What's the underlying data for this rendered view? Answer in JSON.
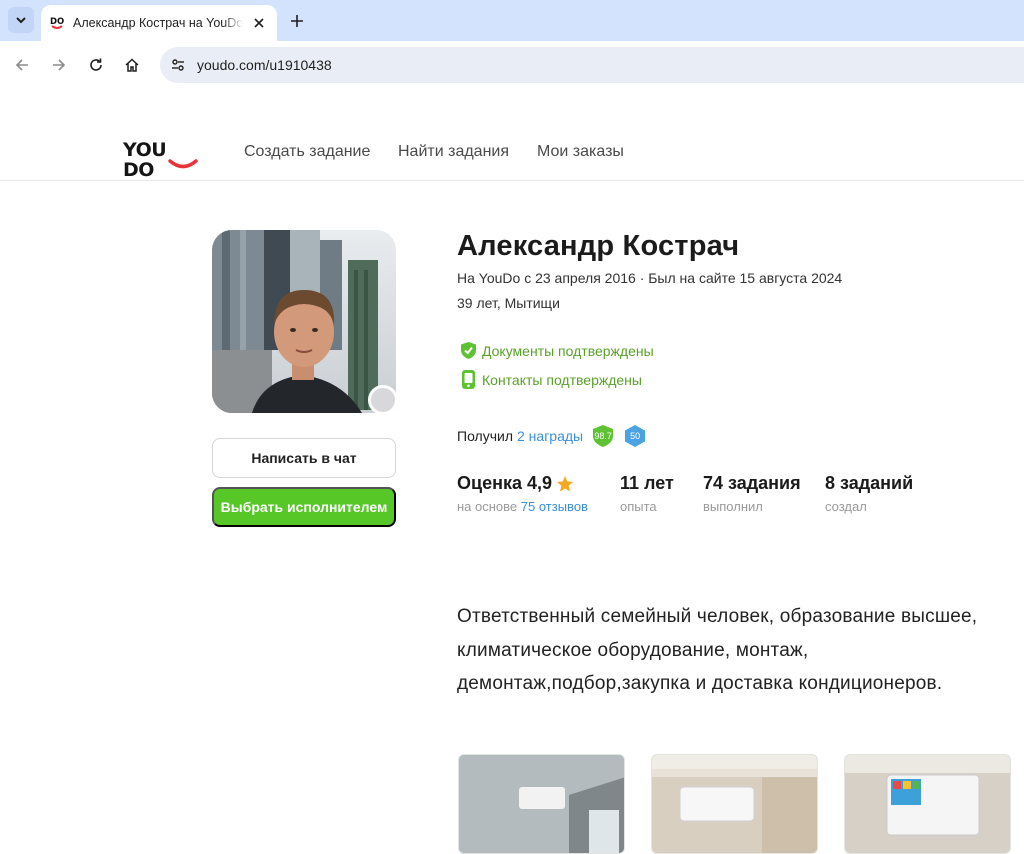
{
  "browser": {
    "tab_title": "Александр Кострач на YouDo",
    "favicon_text": "DO",
    "url": "youdo.com/u1910438"
  },
  "site": {
    "logo_text_1": "YOU",
    "logo_text_2": "DO",
    "nav": [
      "Создать задание",
      "Найти задания",
      "Мои заказы"
    ],
    "colors": {
      "brand_red": "#e8333b",
      "green": "#57c728",
      "link": "#3a8fd8"
    }
  },
  "profile": {
    "name": "Александр Кострач",
    "since": "На YouDo с 23 апреля 2016 · Был на сайте 15 августа 2024",
    "age_city": "39 лет, Мытищи",
    "verifications": [
      "Документы подтверждены",
      "Контакты подтверждены"
    ],
    "awards_prefix": "Получил",
    "awards_link": "2 награды",
    "badges": [
      "98.7",
      "50"
    ],
    "buttons": {
      "chat": "Написать в чат",
      "choose": "Выбрать исполнителем"
    },
    "stats": [
      {
        "value": "Оценка 4,9",
        "sub_prefix": "на основе",
        "sub_link": "75 отзывов",
        "icon": "star-icon"
      },
      {
        "value": "11 лет",
        "sub": "опыта"
      },
      {
        "value": "74 задания",
        "sub": "выполнил"
      },
      {
        "value": "8 заданий",
        "sub": "создал"
      }
    ],
    "about": "Ответственный семейный человек, образование высшее, климатическое оборудование, монтаж, демонтаж,подбор,закупка и доставка кондиционеров."
  }
}
